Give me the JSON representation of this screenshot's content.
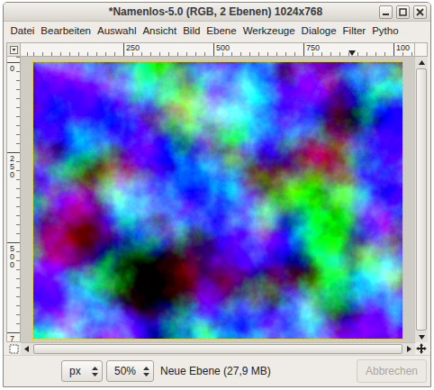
{
  "window": {
    "title": "*Namenlos-5.0 (RGB, 2 Ebenen) 1024x768"
  },
  "menu": [
    "Datei",
    "Bearbeiten",
    "Auswahl",
    "Ansicht",
    "Bild",
    "Ebene",
    "Werkzeuge",
    "Dialoge",
    "Filter",
    "Pytho"
  ],
  "rulers": {
    "horizontal": [
      "250",
      "500",
      "750",
      "100"
    ],
    "vertical": [
      "0",
      "250",
      "500",
      "7"
    ]
  },
  "status_bar": {
    "unit": "px",
    "zoom": "50%",
    "message": "Neue Ebene (27,9 MB)",
    "cancel": {
      "label": "Abbrechen",
      "disabled": true
    }
  }
}
